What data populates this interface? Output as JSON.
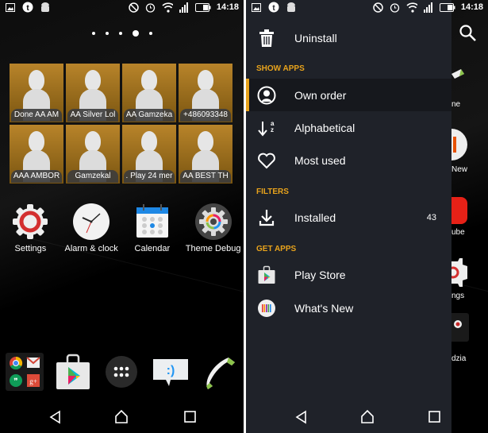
{
  "status_bar": {
    "time": "14:18",
    "left_icons": [
      "image-icon",
      "tapatalk-icon",
      "android-icon"
    ],
    "right_icons": [
      "do-not-disturb-icon",
      "alarm-icon",
      "wifi-icon",
      "signal-icon",
      "battery-icon"
    ]
  },
  "home": {
    "page_indicator": {
      "pages": 5,
      "active": 4
    },
    "contacts": [
      {
        "name": "Done AA AM"
      },
      {
        "name": "AA Silver Lol"
      },
      {
        "name": "AA  Gamzeka"
      },
      {
        "name": "+486093348"
      },
      {
        "name": "AAA AMBOR"
      },
      {
        "name": "Gamzekal"
      },
      {
        "name": ". Play 24 mer"
      },
      {
        "name": "AA BEST TH"
      }
    ],
    "apps": [
      {
        "label": "Settings",
        "icon": "settings-icon"
      },
      {
        "label": "Alarm & clock",
        "icon": "clock-icon"
      },
      {
        "label": "Calendar",
        "icon": "calendar-icon"
      },
      {
        "label": "Theme Debug",
        "icon": "theme-debug-icon"
      }
    ],
    "dock": [
      {
        "name": "google-folder",
        "icon": "google-folder-icon"
      },
      {
        "name": "play-store",
        "icon": "play-store-icon"
      },
      {
        "name": "app-drawer",
        "icon": "app-drawer-icon"
      },
      {
        "name": "messaging",
        "icon": "messaging-icon"
      },
      {
        "name": "phone",
        "icon": "phone-icon"
      }
    ]
  },
  "drawer": {
    "uninstall_label": "Uninstall",
    "sections": {
      "show_apps": "SHOW APPS",
      "filters": "FILTERS",
      "get_apps": "GET APPS"
    },
    "show_apps_items": [
      {
        "label": "Own order",
        "selected": true
      },
      {
        "label": "Alphabetical",
        "selected": false
      },
      {
        "label": "Most used",
        "selected": false
      }
    ],
    "filter_items": [
      {
        "label": "Installed",
        "count": "43"
      }
    ],
    "get_apps_items": [
      {
        "label": "Play Store"
      },
      {
        "label": "What's New"
      }
    ],
    "accent_color": "#e8a31c",
    "background_color": "#1f2229"
  },
  "peek": {
    "labels": [
      "ne",
      "New",
      "ube",
      "ngs",
      "dzia"
    ]
  }
}
